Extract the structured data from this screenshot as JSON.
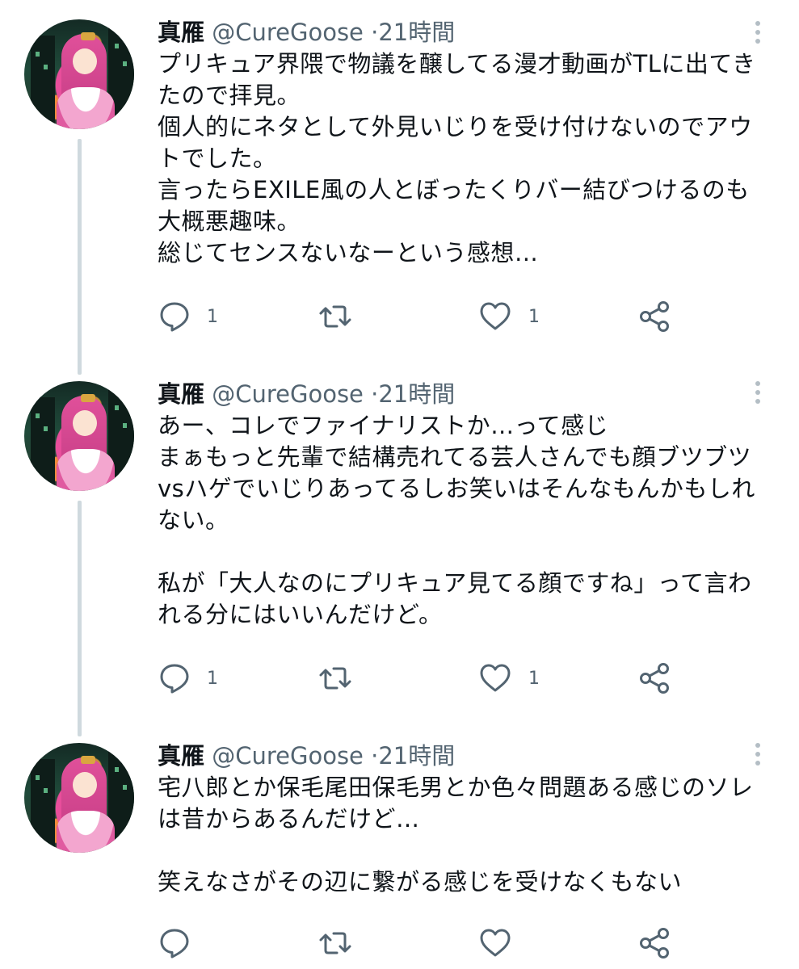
{
  "thread": {
    "tweets": [
      {
        "name": "真雁",
        "handle": "@CureGoose",
        "separator": "·",
        "time": "21時間",
        "lines": [
          "プリキュア界隈で物議を醸してる漫才動画がTLに出てき",
          "たので拝見。",
          "個人的にネタとして外見いじりを受け付けないのでアウ",
          "トでした。",
          "言ったらEXILE風の人とぼったくりバー結びつけるのも",
          "大概悪趣味。",
          "総じてセンスないなーという感想…"
        ],
        "reply_count": "1",
        "retweet_count": "",
        "like_count": "1"
      },
      {
        "name": "真雁",
        "handle": "@CureGoose",
        "separator": "·",
        "time": "21時間",
        "lines": [
          "あー、コレでファイナリストか…って感じ",
          "まぁもっと先輩で結構売れてる芸人さんでも顔ブツブツ",
          "vsハゲでいじりあってるしお笑いはそんなもんかもしれ",
          "ない。",
          "",
          "私が「大人なのにプリキュア見てる顔ですね」って言わ",
          "れる分にはいいんだけど。"
        ],
        "reply_count": "1",
        "retweet_count": "",
        "like_count": "1"
      },
      {
        "name": "真雁",
        "handle": "@CureGoose",
        "separator": "·",
        "time": "21時間",
        "lines": [
          "宅八郎とか保毛尾田保毛男とか色々問題ある感じのソレ",
          "は昔からあるんだけど…",
          "",
          "笑えなさがその辺に繋がる感じを受けなくもない"
        ],
        "reply_count": "",
        "retweet_count": "",
        "like_count": ""
      }
    ]
  },
  "icons": {
    "reply": "reply-bubble-icon",
    "retweet": "retweet-icon",
    "like": "heart-icon",
    "share": "share-icon",
    "more": "more-dots-icon"
  },
  "colors": {
    "text": "#0f1419",
    "secondary": "#536471",
    "thread_line": "#cfd9de"
  }
}
